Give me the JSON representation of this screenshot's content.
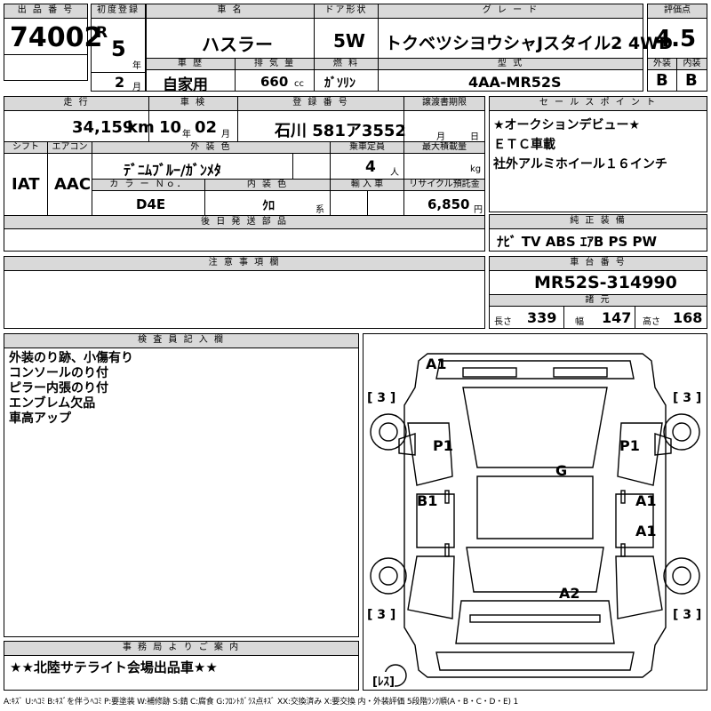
{
  "header": {
    "lot_label": "出 品 番 号",
    "lot": "74002",
    "first_reg_label": "初度登録",
    "era": "R",
    "year": "5",
    "year_unit": "年",
    "month": "2",
    "month_unit": "月",
    "name_label": "車 名",
    "name": "ハスラー",
    "door_label": "ドア形状",
    "door": "5W",
    "grade_label": "グ レ ー ド",
    "grade": "トクベツシヨウシャJスタイル2 4WD",
    "score_label": "評価点",
    "score": "4.5",
    "history_label": "車 歴",
    "history": "自家用",
    "cc_label": "排 気 量",
    "cc": "660",
    "cc_unit": "cc",
    "fuel_label": "燃 料",
    "fuel": "ｶﾞｿﾘﾝ",
    "model_label": "型 式",
    "model": "4AA-MR52S",
    "exterior_label": "外装",
    "exterior": "B",
    "interior_label": "内装",
    "interior": "B"
  },
  "row2": {
    "mileage_label": "走 行",
    "mileage": "34,159",
    "mileage_unit": "km",
    "inspection_label": "車 検",
    "insp_year": "10",
    "insp_year_unit": "年",
    "insp_month": "02",
    "insp_month_unit": "月",
    "plate_label": "登 録 番 号",
    "plate": "石川 581ア3552",
    "transfer_label": "譲渡書期限",
    "transfer_month_unit": "月",
    "transfer_day_unit": "日",
    "shift_label": "シフト",
    "shift": "IAT",
    "ac_label": "エアコン",
    "ac": "AAC",
    "color_label": "外 装 色",
    "color": "ﾃﾞﾆﾑﾌﾞﾙｰ/ｶﾞﾝﾒﾀ",
    "capacity_label": "乗車定員",
    "capacity": "4",
    "capacity_unit": "人",
    "load_label": "最大積載量",
    "load_unit": "kg",
    "color_no_label": "カ ラ ー Ｎｏ．",
    "color_no": "D4E",
    "int_color_label": "内 装 色",
    "int_color": "ｸﾛ",
    "int_color_unit": "系",
    "import_label": "輸 入 車",
    "recycle_label": "リサイクル預託金",
    "recycle": "6,850",
    "recycle_unit": "円",
    "later_label": "後 日 発 送 部 品"
  },
  "sales": {
    "label": "セ ー ル ス ポ イ ン ト",
    "lines": [
      "★オークションデビュー★",
      "ＥＴＣ車載",
      "社外アルミホイール１６インチ"
    ]
  },
  "equipment": {
    "label": "純 正 装 備",
    "value": "ﾅﾋﾞ TV ABS ｴｱB PS PW"
  },
  "notes": {
    "label": "注 意 事 項 欄"
  },
  "chassis": {
    "label": "車 台 番 号",
    "value": "MR52S-314990",
    "dims_label": "諸 元",
    "length_label": "長さ",
    "length": "339",
    "width_label": "幅",
    "width": "147",
    "height_label": "高さ",
    "height": "168"
  },
  "inspector": {
    "label": "検 査 員 記 入 欄",
    "lines": [
      "外装のり跡、小傷有り",
      "コンソールのり付",
      "ピラー内張のり付",
      "エンブレム欠品",
      "車高アップ"
    ]
  },
  "diagram": {
    "marks": [
      "A1",
      "P1",
      "P1",
      "G",
      "B1",
      "A1",
      "A1",
      "A2"
    ],
    "tire_fl": "[ 3 ]",
    "tire_fr": "[ 3 ]",
    "tire_rl": "[ 3 ]",
    "tire_rr": "[ 3 ]",
    "spare": "[ﾚｽ]"
  },
  "office": {
    "label": "事 務 局 よ り ご 案 内",
    "value": "★★北陸サテライト会場出品車★★"
  },
  "legend": "A:ｷｽﾞ U:ﾍｺﾐ B:ｷｽﾞを伴うﾍｺﾐ P:要塗装 W:補修跡 S:錆 C:腐食 G:ﾌﾛﾝﾄｶﾞﾗｽ点ｷｽﾞ XX:交換済み X:要交換 内・外装評価 5段階ﾗﾝｸ順(A・B・C・D・E) 1"
}
